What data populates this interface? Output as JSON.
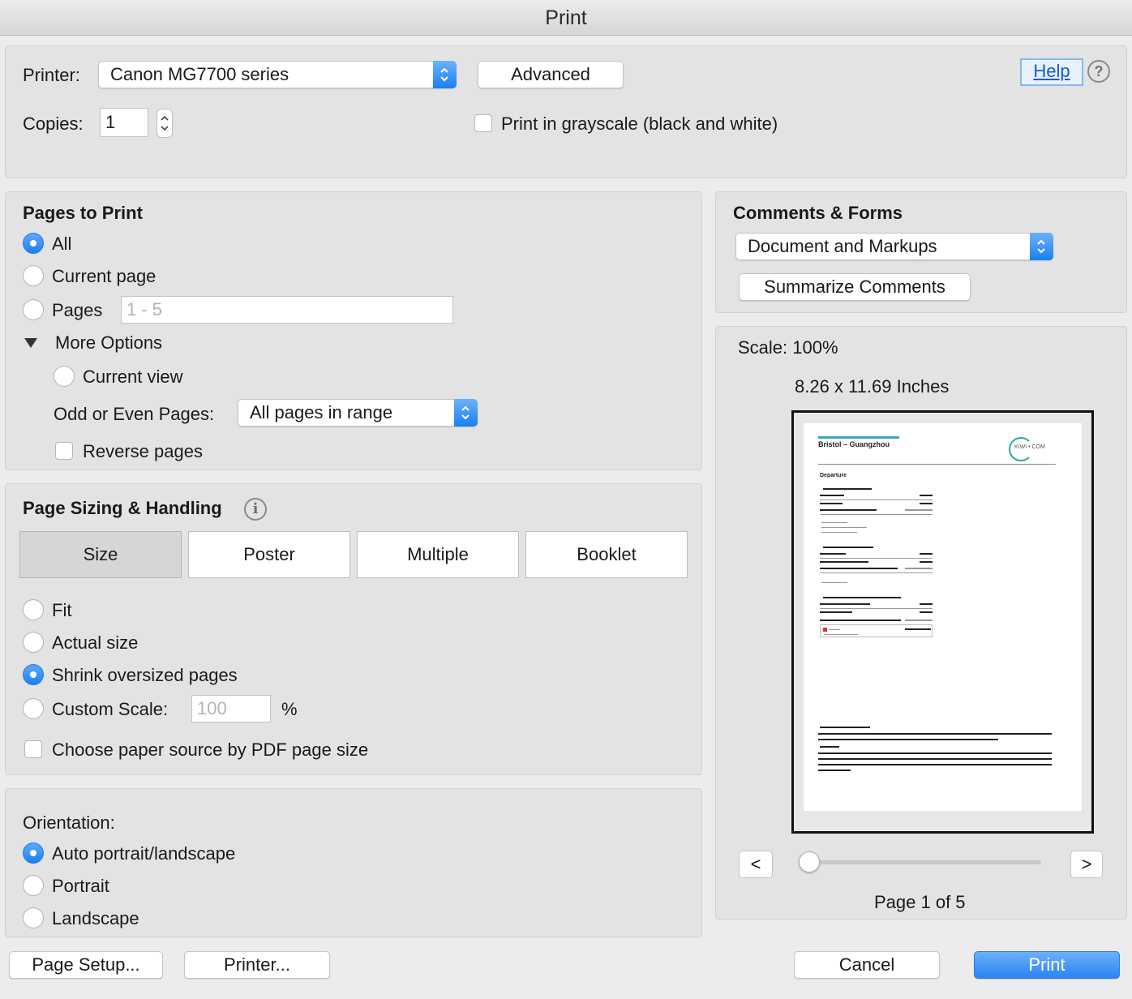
{
  "window": {
    "title": "Print"
  },
  "printer": {
    "label": "Printer:",
    "selected": "Canon MG7700 series",
    "advanced_label": "Advanced",
    "help_label": "Help",
    "help_icon": "?",
    "copies_label": "Copies:",
    "copies_value": "1",
    "grayscale_label": "Print in grayscale (black and white)",
    "grayscale_checked": false
  },
  "pages_to_print": {
    "heading": "Pages to Print",
    "all_label": "All",
    "current_page_label": "Current page",
    "pages_label": "Pages",
    "pages_placeholder": "1 - 5",
    "more_options_label": "More Options",
    "current_view_label": "Current view",
    "odd_even_label": "Odd or Even Pages:",
    "odd_even_selected": "All pages in range",
    "reverse_label": "Reverse pages",
    "selected": "All"
  },
  "page_sizing": {
    "heading": "Page Sizing & Handling",
    "info_icon": "i",
    "tabs": [
      "Size",
      "Poster",
      "Multiple",
      "Booklet"
    ],
    "active_tab": "Size",
    "fit_label": "Fit",
    "actual_size_label": "Actual size",
    "shrink_label": "Shrink oversized pages",
    "custom_scale_label": "Custom Scale:",
    "custom_scale_value": "100",
    "percent_label": "%",
    "paper_source_label": "Choose paper source by PDF page size",
    "selected": "Shrink oversized pages"
  },
  "orientation": {
    "heading": "Orientation:",
    "auto_label": "Auto portrait/landscape",
    "portrait_label": "Portrait",
    "landscape_label": "Landscape",
    "selected": "Auto portrait/landscape"
  },
  "comments_forms": {
    "heading": "Comments & Forms",
    "selected": "Document and Markups",
    "summarize_label": "Summarize Comments"
  },
  "preview": {
    "scale_label": "Scale: 100%",
    "dimensions_label": "8.26 x 11.69 Inches",
    "prev_label": "<",
    "next_label": ">",
    "page_label": "Page 1 of 5",
    "current_page": 1,
    "total_pages": 5,
    "doc_title": "Bristol – Guangzhou",
    "doc_logo": "KIWI • COM",
    "doc_section": "Departure"
  },
  "footer": {
    "page_setup_label": "Page Setup...",
    "printer_label": "Printer...",
    "cancel_label": "Cancel",
    "print_label": "Print"
  },
  "colors": {
    "accent": "#1d7ff1",
    "link": "#0f5bd8"
  }
}
